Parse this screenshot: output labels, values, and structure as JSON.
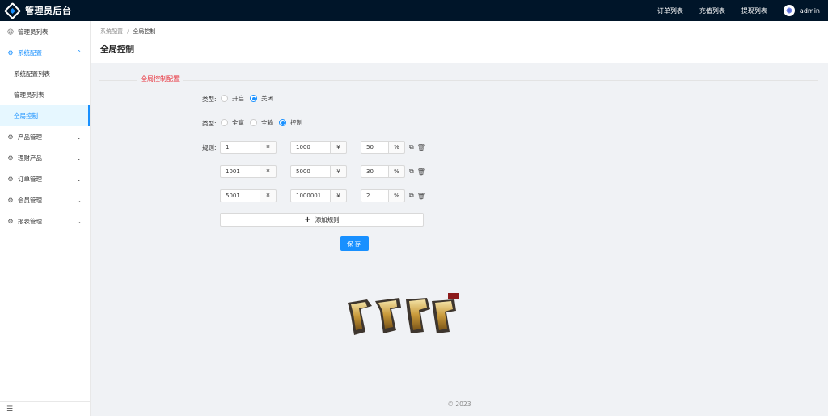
{
  "header": {
    "brand_title": "管理员后台",
    "nav": [
      "订单列表",
      "充值列表",
      "提现列表"
    ],
    "user_name": "admin"
  },
  "sidebar": {
    "items": [
      {
        "label": "管理员列表",
        "icon": "user-circle-icon"
      },
      {
        "label": "系统配置",
        "icon": "gear-icon",
        "open": true,
        "children": [
          {
            "label": "系统配置列表"
          },
          {
            "label": "管理员列表"
          },
          {
            "label": "全局控制",
            "active": true
          }
        ]
      },
      {
        "label": "产品管理",
        "icon": "gear-icon"
      },
      {
        "label": "理财产品",
        "icon": "gear-icon"
      },
      {
        "label": "订单管理",
        "icon": "gear-icon"
      },
      {
        "label": "会员管理",
        "icon": "gear-icon"
      },
      {
        "label": "报表管理",
        "icon": "gear-icon"
      }
    ],
    "collapse_icon": "menu-fold-icon"
  },
  "breadcrumb": {
    "parent": "系统配置",
    "separator": "/",
    "current": "全局控制"
  },
  "page_title": "全局控制",
  "form": {
    "section_title": "全局控制配置",
    "type1": {
      "label": "类型:",
      "options": [
        "开启",
        "关闭"
      ],
      "selected": "关闭"
    },
    "type2": {
      "label": "类型:",
      "options": [
        "全赢",
        "全输",
        "控制"
      ],
      "selected": "控制"
    },
    "rules_label": "规则:",
    "currency_unit": "¥",
    "percent_unit": "%",
    "rules": [
      {
        "min": "1",
        "max": "1000",
        "percent": "50"
      },
      {
        "min": "1001",
        "max": "5000",
        "percent": "30"
      },
      {
        "min": "5001",
        "max": "1000001",
        "percent": "2"
      }
    ],
    "add_rule_label": "添加规则",
    "save_label": "保存"
  },
  "footer": {
    "text": "© 2023"
  },
  "colors": {
    "header_bg": "#001529",
    "accent": "#1890ff",
    "section_title": "#e8303a"
  }
}
